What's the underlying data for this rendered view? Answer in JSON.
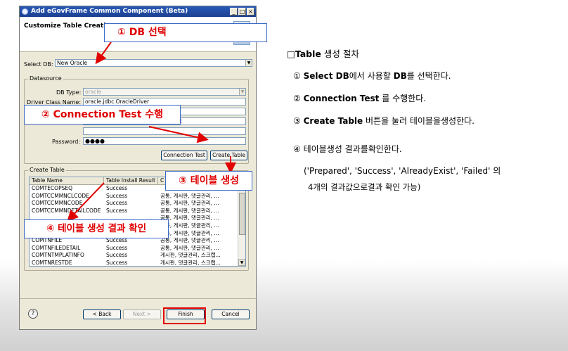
{
  "window": {
    "title": "Add eGovFrame Common Component (Beta)",
    "controls": [
      "_",
      "□",
      "×"
    ]
  },
  "header": {
    "title": "Customize Table Creation"
  },
  "select_db": {
    "label": "Select DB:",
    "value": "New Oracle"
  },
  "datasource": {
    "group_label": "Datasource",
    "db_type_label": "DB Type:",
    "db_type_value": "oracle",
    "driver_label": "Driver Class Name:",
    "driver_value": "oracle.jdbc.OracleDriver",
    "url_fragment": "E",
    "url_prefix_partial": "",
    "password_label": "Password:",
    "password_value": "●●●●",
    "connection_test_button": "Connection Test",
    "create_table_button": "Create Table"
  },
  "create_table": {
    "group_label": "Create Table",
    "columns": [
      "Table Name",
      "Table Install Result",
      "C"
    ],
    "rows": [
      [
        "COMTECOPSEQ",
        "Success",
        ""
      ],
      [
        "COMTCCMMNCLCODE",
        "Success",
        "공통, 게시판, 댓글관리, ..."
      ],
      [
        "COMTCCMMNCODE",
        "Success",
        "공통, 게시판, 댓글관리, ..."
      ],
      [
        "COMTCCMMNDETAILCODE",
        "Success",
        "공통, 게시판, 댓글관리, ..."
      ],
      [
        "",
        "",
        "공통, 게시판, 댓글관리, ..."
      ],
      [
        "",
        "",
        "공통, 게시판, 댓글관리, ..."
      ],
      [
        "",
        "",
        "공통, 게시판, 댓글관리, ..."
      ],
      [
        "COMTNFILE",
        "Success",
        "공통, 게시판, 댓글관리, ..."
      ],
      [
        "COMTNFILEDETAIL",
        "Success",
        "공통, 게시판, 댓글관리, ..."
      ],
      [
        "COMTNTMPLATINFO",
        "Success",
        "게시판, 댓글관리, 스크랩..."
      ],
      [
        "COMTNRESTDE",
        "Success",
        "게시판, 댓글관리, 스크랩..."
      ]
    ]
  },
  "footer": {
    "help": "?",
    "back": "< Back",
    "next": "Next >",
    "finish": "Finish",
    "cancel": "Cancel"
  },
  "callouts": {
    "c1": "① DB 선택",
    "c2": "② Connection Test 수행",
    "c3": "③ 테이블 생성",
    "c4": "④ 테이블 생성 결과 확인"
  },
  "procedure": {
    "title_prefix": "□",
    "title_bold": "Table",
    "title_rest": " 생성 절차",
    "step1_num": "①",
    "step1_bold": "Select DB",
    "step1_rest1": "에서 사용할 ",
    "step1_bold2": "DB",
    "step1_rest2": "를 선택한다.",
    "step2_num": "②",
    "step2_bold": "Connection Test",
    "step2_rest": "를 수행한다.",
    "step3_num": "③",
    "step3_bold": "Create Table",
    "step3_rest": " 버튼을 눌러 테이블을생성한다.",
    "step4_num": "④",
    "step4_rest": "테이블생성 결과를확인한다.",
    "result_values": "('Prepared', 'Success', 'AlreadyExist', 'Failed'",
    "result_tail": "의",
    "result_line2": "4개의 결과값으로결과 확인 가능)"
  },
  "colors": {
    "callout_text": "#e00000",
    "callout_border": "#3a6ac8",
    "highlight": "#e00000",
    "result_blue": "#1a3da6"
  }
}
